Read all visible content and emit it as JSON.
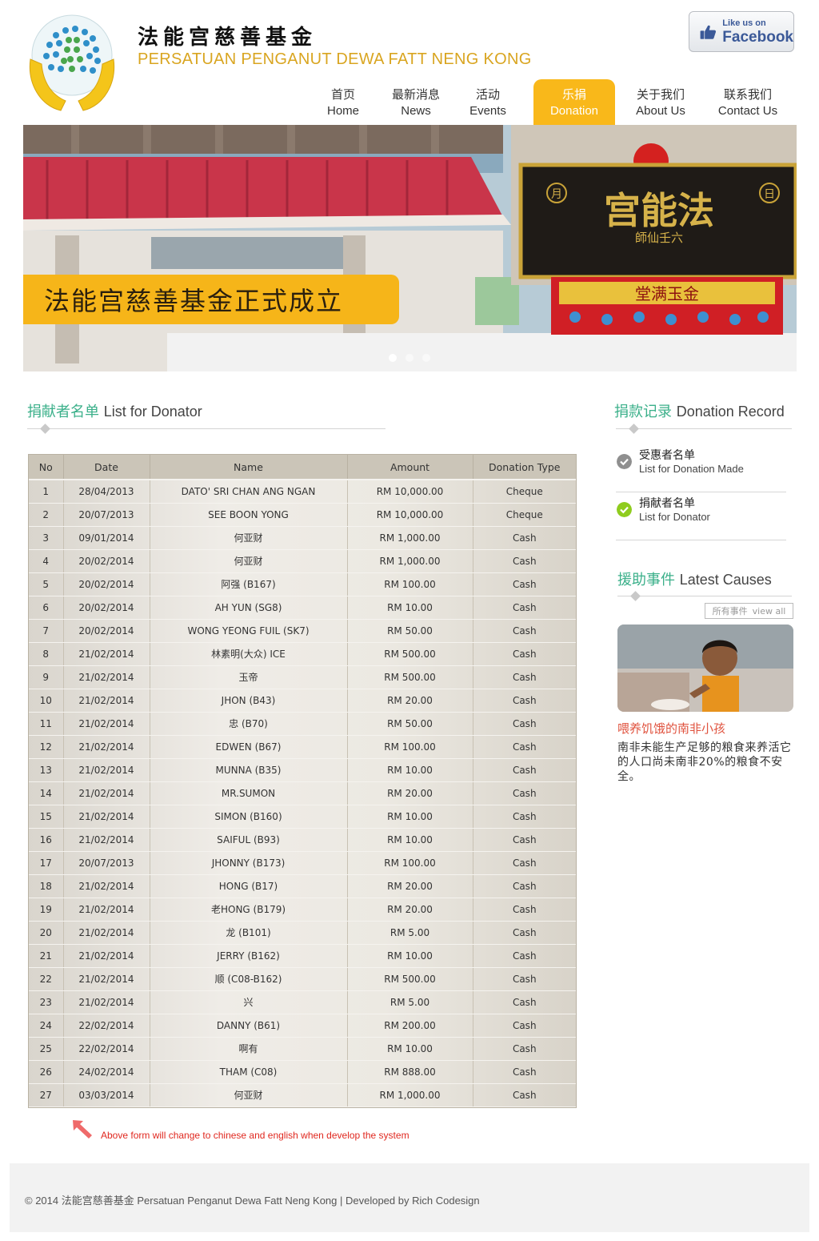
{
  "header": {
    "title_cn": "法能宫慈善基金",
    "title_en": "PERSATUAN PENGANUT DEWA FATT NENG KONG",
    "facebook_small": "Like us on",
    "facebook_big": "Facebook"
  },
  "nav": [
    {
      "cn": "首页",
      "en": "Home"
    },
    {
      "cn": "最新消息",
      "en": "News"
    },
    {
      "cn": "活动",
      "en": "Events"
    },
    {
      "cn": "乐捐",
      "en": "Donation"
    },
    {
      "cn": "关于我们",
      "en": "About Us"
    },
    {
      "cn": "联系我们",
      "en": "Contact Us"
    }
  ],
  "banner": {
    "caption": "法能宫慈善基金正式成立",
    "sign_main": "宫能法",
    "sign_sub": "師仙壬六",
    "sign_left": "月",
    "sign_right": "日",
    "red_banner": "堂满玉金",
    "slide_count": 3,
    "active_slide": 1
  },
  "donor_list": {
    "heading_cn": "捐献者名单",
    "heading_en": "List for Donator",
    "columns": [
      "No",
      "Date",
      "Name",
      "Amount",
      "Donation Type"
    ],
    "rows": [
      [
        "1",
        "28/04/2013",
        "DATO' SRI CHAN ANG NGAN",
        "RM 10,000.00",
        "Cheque"
      ],
      [
        "2",
        "20/07/2013",
        "SEE BOON YONG",
        "RM 10,000.00",
        "Cheque"
      ],
      [
        "3",
        "09/01/2014",
        "何亚财",
        "RM 1,000.00",
        "Cash"
      ],
      [
        "4",
        "20/02/2014",
        "何亚财",
        "RM 1,000.00",
        "Cash"
      ],
      [
        "5",
        "20/02/2014",
        "阿强 (B167)",
        "RM 100.00",
        "Cash"
      ],
      [
        "6",
        "20/02/2014",
        "AH YUN (SG8)",
        "RM 10.00",
        "Cash"
      ],
      [
        "7",
        "20/02/2014",
        "WONG YEONG FUIL (SK7)",
        "RM 50.00",
        "Cash"
      ],
      [
        "8",
        "21/02/2014",
        "林素明(大众) ICE",
        "RM 500.00",
        "Cash"
      ],
      [
        "9",
        "21/02/2014",
        "玉帝",
        "RM 500.00",
        "Cash"
      ],
      [
        "10",
        "21/02/2014",
        "JHON (B43)",
        "RM 20.00",
        "Cash"
      ],
      [
        "11",
        "21/02/2014",
        "忠 (B70)",
        "RM 50.00",
        "Cash"
      ],
      [
        "12",
        "21/02/2014",
        "EDWEN (B67)",
        "RM 100.00",
        "Cash"
      ],
      [
        "13",
        "21/02/2014",
        "MUNNA (B35)",
        "RM 10.00",
        "Cash"
      ],
      [
        "14",
        "21/02/2014",
        "MR.SUMON",
        "RM 20.00",
        "Cash"
      ],
      [
        "15",
        "21/02/2014",
        "SIMON (B160)",
        "RM 10.00",
        "Cash"
      ],
      [
        "16",
        "21/02/2014",
        "SAIFUL (B93)",
        "RM 10.00",
        "Cash"
      ],
      [
        "17",
        "20/07/2013",
        "JHONNY (B173)",
        "RM 100.00",
        "Cash"
      ],
      [
        "18",
        "21/02/2014",
        "HONG (B17)",
        "RM 20.00",
        "Cash"
      ],
      [
        "19",
        "21/02/2014",
        "老HONG (B179)",
        "RM 20.00",
        "Cash"
      ],
      [
        "20",
        "21/02/2014",
        "龙 (B101)",
        "RM 5.00",
        "Cash"
      ],
      [
        "21",
        "21/02/2014",
        "JERRY (B162)",
        "RM 10.00",
        "Cash"
      ],
      [
        "22",
        "21/02/2014",
        "顺 (C08-B162)",
        "RM 500.00",
        "Cash"
      ],
      [
        "23",
        "21/02/2014",
        "兴",
        "RM 5.00",
        "Cash"
      ],
      [
        "24",
        "22/02/2014",
        "DANNY (B61)",
        "RM 200.00",
        "Cash"
      ],
      [
        "25",
        "22/02/2014",
        "啊有",
        "RM 10.00",
        "Cash"
      ],
      [
        "26",
        "24/02/2014",
        "THAM (C08)",
        "RM 888.00",
        "Cash"
      ],
      [
        "27",
        "03/03/2014",
        "何亚财",
        "RM 1,000.00",
        "Cash"
      ]
    ],
    "note": "Above form will change to chinese and english when develop the system"
  },
  "donation_record": {
    "heading_cn": "捐款记录",
    "heading_en": "Donation Record",
    "items": [
      {
        "cn": "受惠者名单",
        "en": "List for Donation Made",
        "state": "unchecked"
      },
      {
        "cn": "捐献者名单",
        "en": "List for Donator",
        "state": "checked"
      }
    ]
  },
  "latest_causes": {
    "heading_cn": "援助事件",
    "heading_en": "Latest Causes",
    "view_all_cn": "所有事件",
    "view_all_en": "view all",
    "cause_title": "喂养饥饿的南非小孩",
    "cause_text": "南非未能生产足够的粮食来养活它的人口尚未南非20%的粮食不安全。"
  },
  "footer": {
    "text": "© 2014 法能宫慈善基金  Persatuan Penganut Dewa Fatt Neng Kong  |   Developed by Rich Codesign"
  },
  "colors": {
    "accent_yellow": "#f9b81a",
    "accent_green": "#3bb08a",
    "cause_red": "#e0533f",
    "note_red": "#e0281f",
    "facebook_blue": "#3b5998"
  }
}
